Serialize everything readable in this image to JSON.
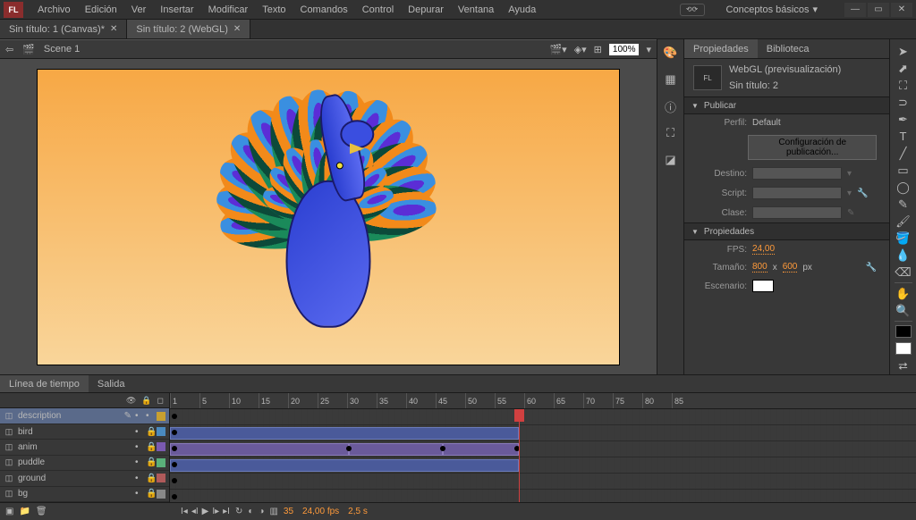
{
  "menu": {
    "logo": "FL",
    "items": [
      "Archivo",
      "Edición",
      "Ver",
      "Insertar",
      "Modificar",
      "Texto",
      "Comandos",
      "Control",
      "Depurar",
      "Ventana",
      "Ayuda"
    ],
    "workspace": "Conceptos básicos"
  },
  "tabs": [
    {
      "label": "Sin título: 1 (Canvas)*",
      "active": false
    },
    {
      "label": "Sin título: 2 (WebGL)",
      "active": true
    }
  ],
  "scene": {
    "name": "Scene 1",
    "zoom": "100%"
  },
  "props": {
    "tabs": [
      "Propiedades",
      "Biblioteca"
    ],
    "doc_type": "WebGL (previsualización)",
    "doc_name": "Sin título: 2",
    "publish_hd": "Publicar",
    "profile_lbl": "Perfil:",
    "profile_val": "Default",
    "pub_btn": "Configuración de publicación...",
    "dest_lbl": "Destino:",
    "script_lbl": "Script:",
    "clase_lbl": "Clase:",
    "props_hd": "Propiedades",
    "fps_lbl": "FPS:",
    "fps_val": "24,00",
    "size_lbl": "Tamaño:",
    "w": "800",
    "x": "x",
    "h": "600",
    "px": "px",
    "stage_lbl": "Escenario:"
  },
  "timeline": {
    "tabs": [
      "Línea de tiempo",
      "Salida"
    ],
    "ruler": [
      "1",
      "5",
      "10",
      "15",
      "20",
      "25",
      "30",
      "35",
      "40",
      "45",
      "50",
      "55",
      "60",
      "65",
      "70",
      "75",
      "80",
      "85"
    ],
    "layers": [
      {
        "name": "description",
        "active": true
      },
      {
        "name": "bird",
        "active": false
      },
      {
        "name": "anim",
        "active": false
      },
      {
        "name": "puddle",
        "active": false
      },
      {
        "name": "ground",
        "active": false
      },
      {
        "name": "bg",
        "active": false
      }
    ],
    "foot": {
      "frame": "35",
      "fps": "24,00 fps",
      "time": "2,5 s"
    }
  }
}
